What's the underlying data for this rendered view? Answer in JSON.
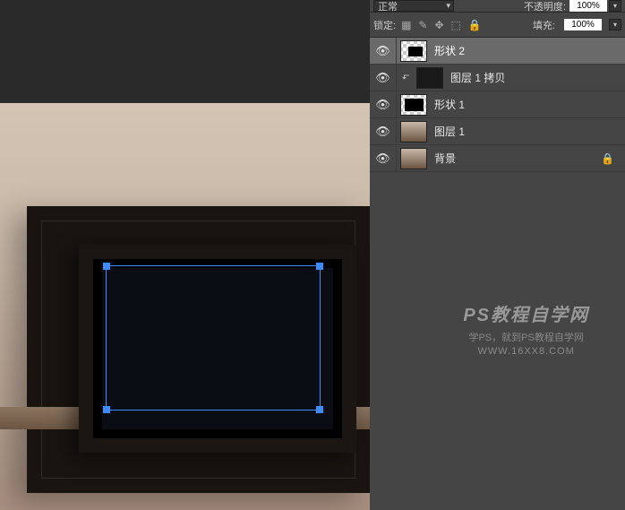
{
  "options": {
    "blend_mode": "正常",
    "opacity_label": "不透明度:",
    "opacity_value": "100%",
    "lock_label": "锁定:",
    "fill_label": "填充:",
    "fill_value": "100%"
  },
  "layers": [
    {
      "name": "形状 2",
      "selected": true,
      "thumb": "checker-shape"
    },
    {
      "name": "图层 1 拷贝",
      "selected": false,
      "thumb": "dark",
      "clipped": true
    },
    {
      "name": "形状 1",
      "selected": false,
      "thumb": "checker-shape2"
    },
    {
      "name": "图层 1",
      "selected": false,
      "thumb": "photo"
    },
    {
      "name": "背景",
      "selected": false,
      "thumb": "photo",
      "locked": true
    }
  ],
  "watermark": {
    "title": "PS教程自学网",
    "subtitle": "学PS，就到PS教程自学网",
    "url": "WWW.16XX8.COM"
  }
}
